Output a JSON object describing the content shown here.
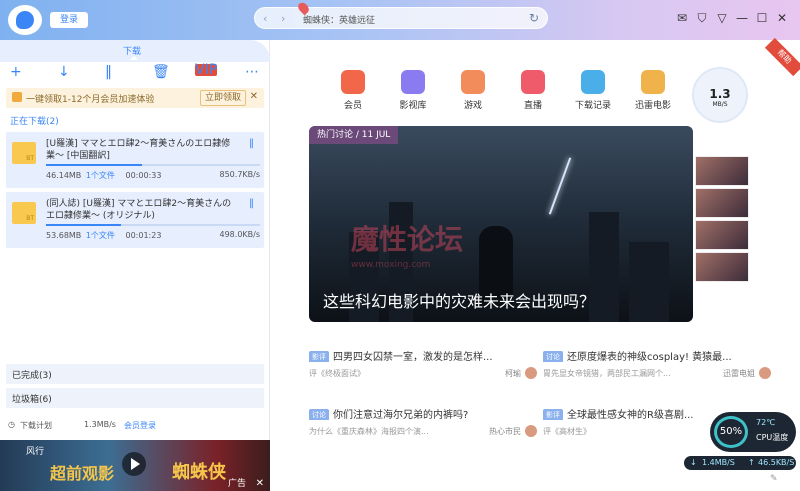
{
  "header": {
    "login_label": "登录",
    "search_text": "蜘蛛侠：英雄远征",
    "window_icons": [
      "mail-icon",
      "shirt-icon",
      "filter-icon",
      "minimize-icon",
      "maximize-icon",
      "close-icon"
    ]
  },
  "left": {
    "tab_label": "下载",
    "toolbar_icons": [
      "plus-icon",
      "download-arrow-icon",
      "pause-icon",
      "trash-icon",
      "vip-icon",
      "more-icon"
    ],
    "vip_label": "VIP",
    "promo": {
      "text": "一键领取1-12个月会员加速体验",
      "button": "立即领取",
      "close": "✕"
    },
    "downloading_title": "正在下载(2)",
    "items": [
      {
        "name": "[U羅漢] ママとエロ肆2～育美さんのエロ隷修業～ [中国翻訳]",
        "size": "46.14MB",
        "files": "1个文件",
        "time": "00:00:33",
        "speed": "850.7KB/s",
        "progress": 0.45
      },
      {
        "name": "(同人誌) [U羅漢] ママとエロ肆2～育美さんのエロ隷修業～ (オリジナル)",
        "size": "53.68MB",
        "files": "1个文件",
        "time": "00:01:23",
        "speed": "498.0KB/s",
        "progress": 0.35
      }
    ],
    "completed": "已完成(3)",
    "trash": "垃圾箱(6)",
    "status": {
      "plan": "下载计划",
      "speed": "1.3MB/s",
      "member": "会员登录"
    },
    "ad": {
      "line1": "风行",
      "line2": "超前观影",
      "line3": "蜘蛛侠",
      "label": "广告",
      "close": "✕"
    }
  },
  "right": {
    "nav": [
      {
        "label": "会员",
        "color": "#f2674a"
      },
      {
        "label": "影视库",
        "color": "#8a7cf0"
      },
      {
        "label": "游戏",
        "color": "#f28c5a"
      },
      {
        "label": "直播",
        "color": "#ef5b6b"
      },
      {
        "label": "下载记录",
        "color": "#4aaee8"
      },
      {
        "label": "迅雷电影",
        "color": "#f0b24a"
      }
    ],
    "speed": {
      "value": "1.3",
      "unit": "MB/S"
    },
    "ribbon": "帮助",
    "hero": {
      "tag": "热门讨论 / 11 JUL",
      "title": "这些科幻电影中的灾难未来会出现吗？"
    },
    "watermark": {
      "main": "魔性论坛",
      "sub": "www.moxing.com"
    },
    "news": [
      {
        "tag": "影评",
        "title": "四男四女囚禁一室，激发的是怎样...",
        "sub": "评《终极面试》",
        "author": "柯瑜"
      },
      {
        "tag": "讨论",
        "title": "还原度爆表的神级cosplay! 黄猿最...",
        "sub": "胃先显女帝镜猎，两部民工漏网个...",
        "author": "迅雷电姐"
      },
      {
        "tag": "讨论",
        "title": "你们注意过海尔兄弟的内裤吗?",
        "sub": "为什么《重庆森林》海报四个演...",
        "author": "热心市民"
      },
      {
        "tag": "影评",
        "title": "全球最性感女神的R级喜剧...",
        "sub": "评《高材生》",
        "author": ""
      }
    ],
    "cpu": {
      "percent": "50%",
      "temp": "72℃",
      "label": "CPU温度"
    },
    "net": {
      "down": "1.4MB/S",
      "up": "46.5KB/S"
    },
    "help": "✎"
  }
}
